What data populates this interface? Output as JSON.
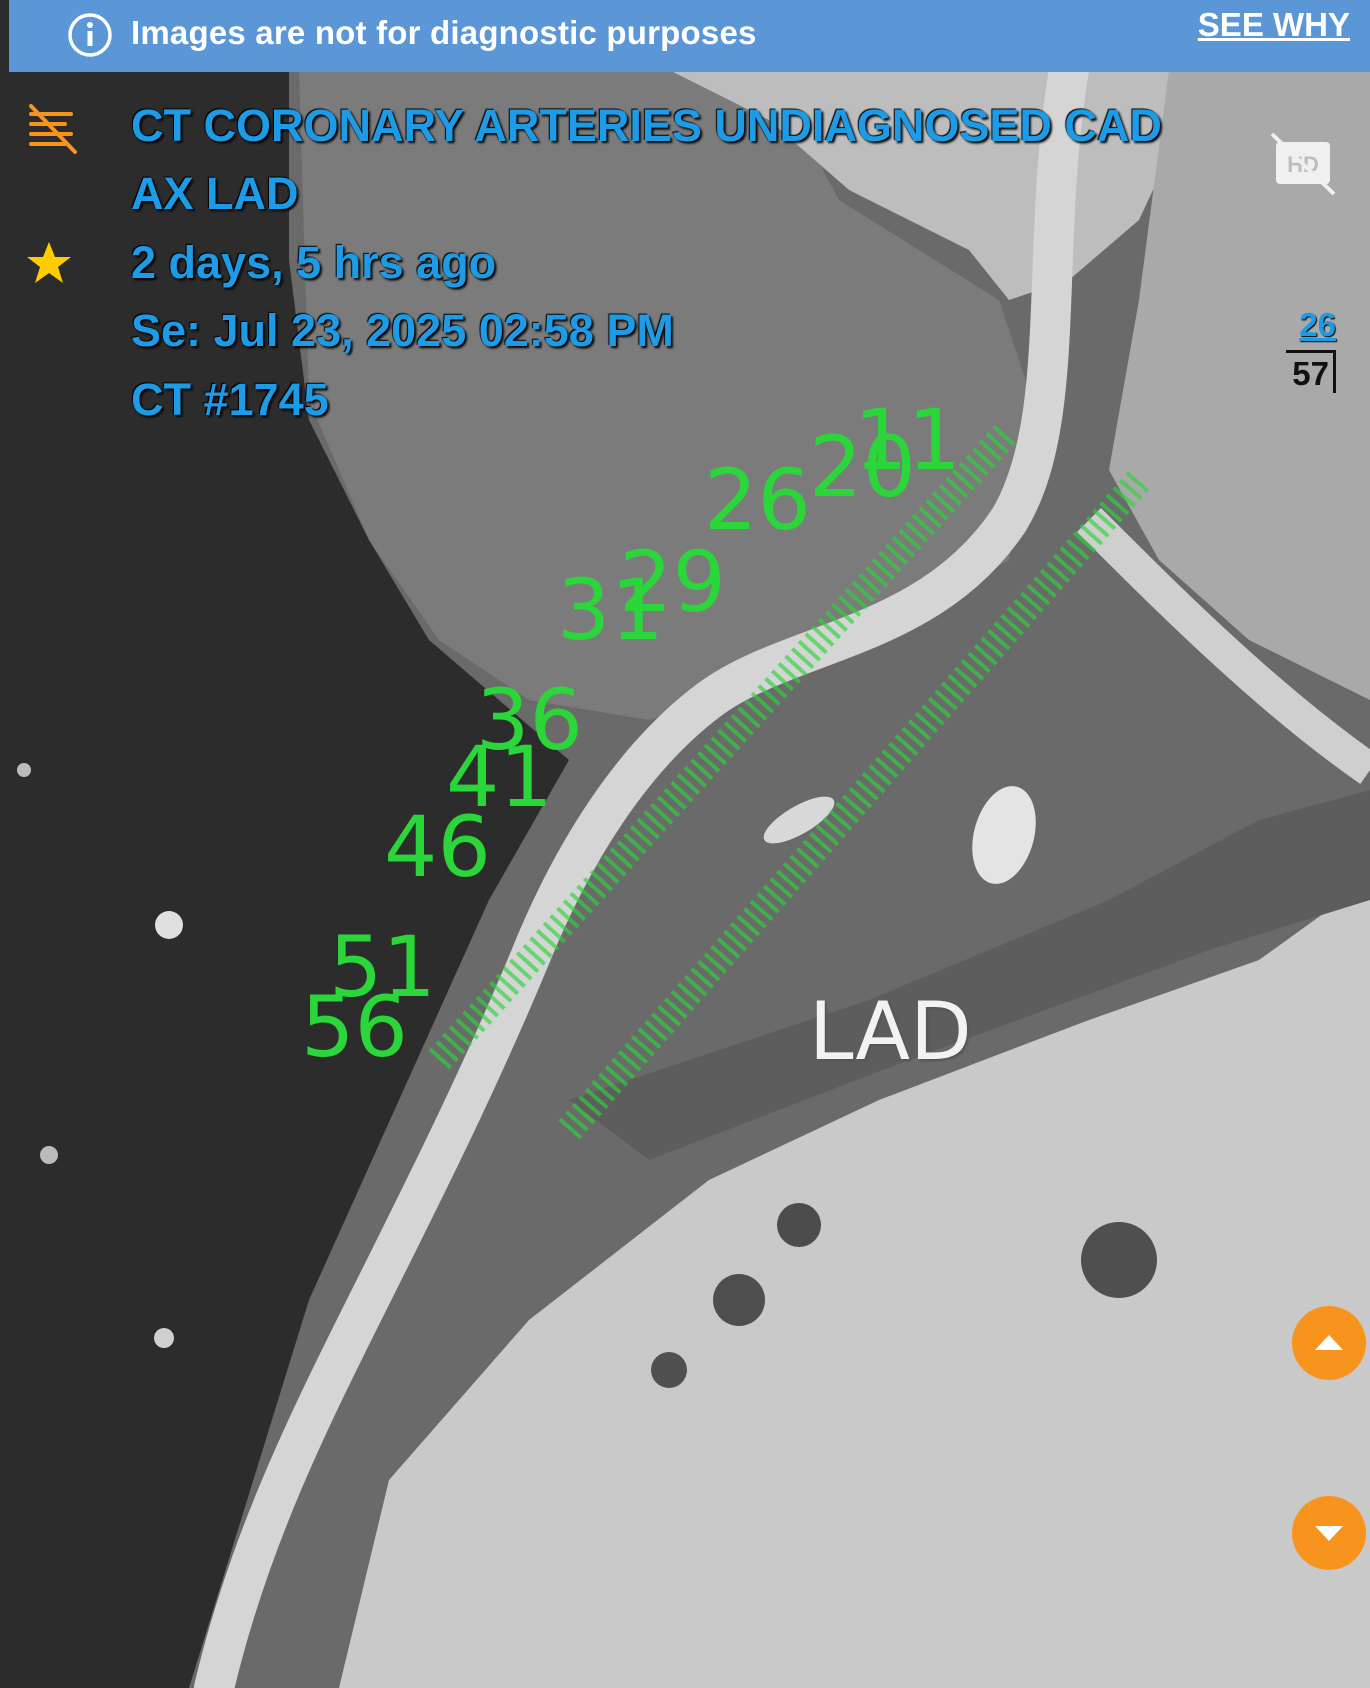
{
  "banner": {
    "message": "Images are not for diagnostic purposes",
    "link_label": "SEE WHY"
  },
  "study": {
    "title": "CT CORONARY ARTERIES UNDIAGNOSED CAD",
    "series_name": "AX LAD",
    "relative_time": "2 days, 5 hrs ago",
    "series_date": "Se: Jul 23, 2025 02:58 PM",
    "study_id": "CT #1745"
  },
  "slice": {
    "current": "26",
    "total": "57"
  },
  "image": {
    "vessel_label": "LAD",
    "measurement_markers": [
      "11",
      "20",
      "26",
      "29",
      "31",
      "36",
      "41",
      "46",
      "51",
      "56"
    ]
  },
  "colors": {
    "banner_bg": "#5b96d6",
    "overlay_text": "#1e9be6",
    "marker_green": "#2bd63a",
    "nav_button": "#f7941d",
    "star": "#ffcc00",
    "menu_icon": "#f7941d"
  },
  "icons": {
    "banner": "info-icon",
    "menu": "menu-hide-icon",
    "favorite": "star-icon",
    "quality": "hd-off-icon",
    "prev": "chevron-up-icon",
    "next": "chevron-down-icon"
  }
}
